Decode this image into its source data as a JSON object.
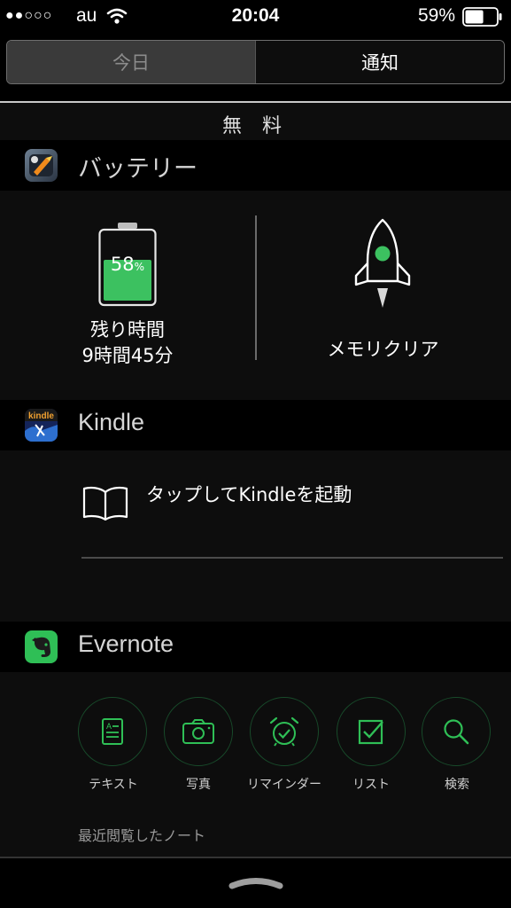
{
  "status_bar": {
    "signal": "●●○○○",
    "carrier": "au",
    "time": "20:04",
    "battery_percent": "59%",
    "battery_level": 0.59
  },
  "segments": [
    {
      "label": "今日",
      "selected": false
    },
    {
      "label": "通知",
      "selected": true
    }
  ],
  "section_label": "無 料",
  "battery_widget": {
    "title": "バッテリー",
    "percent": "58",
    "percent_sign": "%",
    "level": 0.58,
    "remaining_label": "残り時間",
    "remaining_value": "9時間45分",
    "memory_clear_label": "メモリクリア",
    "accent_color": "#3cc160"
  },
  "kindle_widget": {
    "title": "Kindle",
    "launch_label": "タップしてKindleを起動"
  },
  "evernote_widget": {
    "title": "Evernote",
    "actions": [
      {
        "label": "テキスト",
        "icon": "text-note-icon"
      },
      {
        "label": "写真",
        "icon": "camera-icon"
      },
      {
        "label": "リマインダー",
        "icon": "alarm-clock-icon"
      },
      {
        "label": "リスト",
        "icon": "checkbox-icon"
      },
      {
        "label": "検索",
        "icon": "search-icon"
      }
    ],
    "recent_label": "最近閲覧したノート",
    "accent_color": "#2fbf56"
  }
}
